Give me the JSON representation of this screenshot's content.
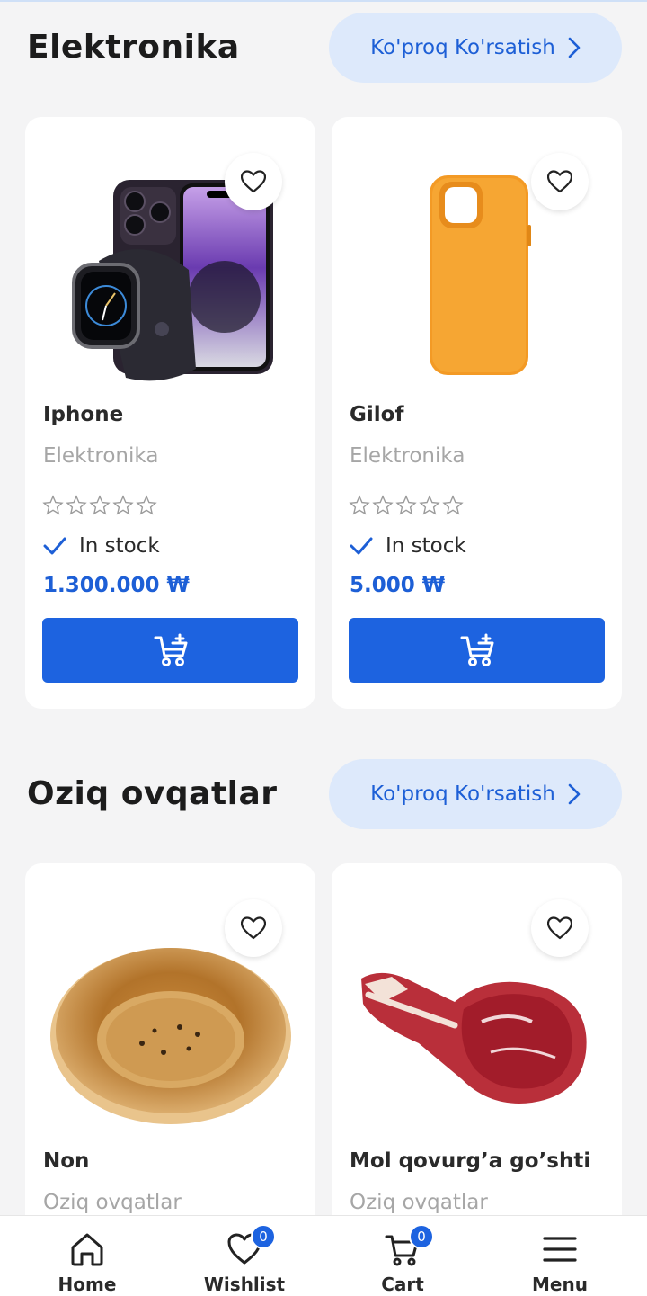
{
  "sections": [
    {
      "title": "Elektronika",
      "more_label": "Ko'proq Ko'rsatish",
      "products": [
        {
          "name": "Iphone",
          "category": "Elektronika",
          "rating": 0,
          "stock": "In stock",
          "price": "1.300.000 ₩",
          "image": "iphone-and-watch"
        },
        {
          "name": "Gilof",
          "category": "Elektronika",
          "rating": 0,
          "stock": "In stock",
          "price": "5.000 ₩",
          "image": "orange-phone-case"
        }
      ]
    },
    {
      "title": "Oziq ovqatlar",
      "more_label": "Ko'proq Ko'rsatish",
      "products": [
        {
          "name": "Non",
          "category": "Oziq ovqatlar",
          "image": "bread"
        },
        {
          "name": "Mol qovurg’a go’shti",
          "category": "Oziq ovqatlar",
          "image": "beef-rib"
        }
      ]
    }
  ],
  "nav": {
    "home": "Home",
    "wishlist": "Wishlist",
    "wishlist_count": "0",
    "cart": "Cart",
    "cart_count": "0",
    "menu": "Menu"
  },
  "colors": {
    "primary": "#1d63e0",
    "accent_text": "#1d5fd6",
    "pill_bg": "#dde9fb"
  }
}
